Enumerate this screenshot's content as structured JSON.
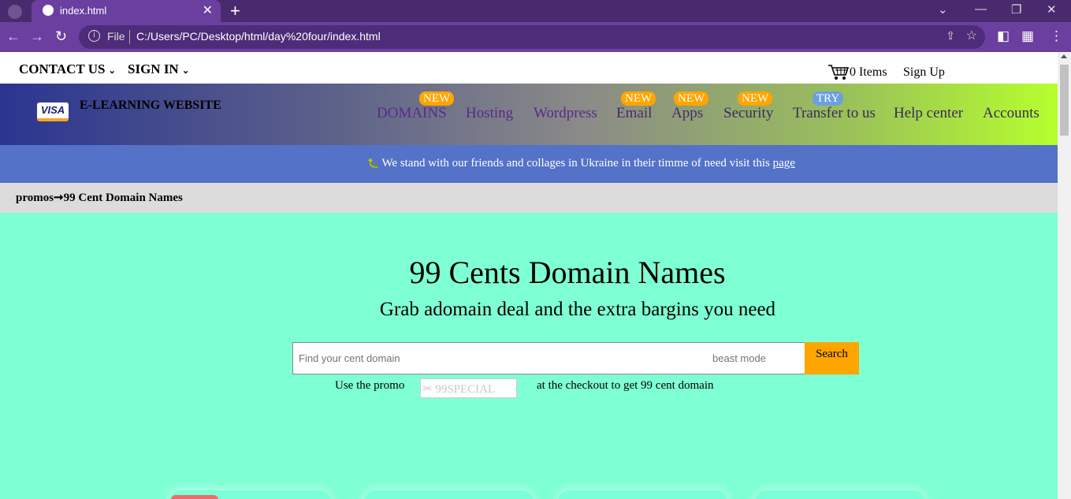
{
  "browser": {
    "tab_title": "index.html",
    "file_label": "File",
    "url": "C:/Users/PC/Desktop/html/day%20four/index.html"
  },
  "topbar": {
    "contact": "CONTACT US",
    "signin": "SIGN IN",
    "cart_items": "0 Items",
    "signup": "Sign Up"
  },
  "header": {
    "brand": "E-LEARNING WEBSITE",
    "logo_text": "VISA",
    "nav": [
      {
        "label": "DOMAINS",
        "badge": "NEW"
      },
      {
        "label": "Hosting"
      },
      {
        "label": "Wordpress"
      },
      {
        "label": "Email",
        "badge": "NEW"
      },
      {
        "label": "Apps",
        "badge": "NEW"
      },
      {
        "label": "Security",
        "badge": "NEW"
      },
      {
        "label": "Transfer to us",
        "badge": "TRY"
      },
      {
        "label": "Help center"
      },
      {
        "label": "Accounts"
      }
    ]
  },
  "banner": {
    "icon": "🐛",
    "message": "We stand with our friends and collages in Ukraine in their timme of need visit this",
    "link": "page"
  },
  "breadcrumb": {
    "text": "promos➞99 Cent Domain Names"
  },
  "hero": {
    "title": "99 Cents Domain Names",
    "subtitle": "Grab adomain deal and the extra bargins you need",
    "search_placeholder": "Find your  cent domain",
    "search_hint": "beast mode",
    "search_button": "Search",
    "promo_before": "Use the promo",
    "promo_code": "✂ 99SPECIAL",
    "promo_after": "at the checkout to get 99 cent domain"
  },
  "colors": {
    "page_bg": "#7fffd4",
    "badge_new": "#ffa500",
    "badge_try": "#6aa0e0",
    "banner": "#5472c8",
    "search_button": "#ffa500"
  }
}
